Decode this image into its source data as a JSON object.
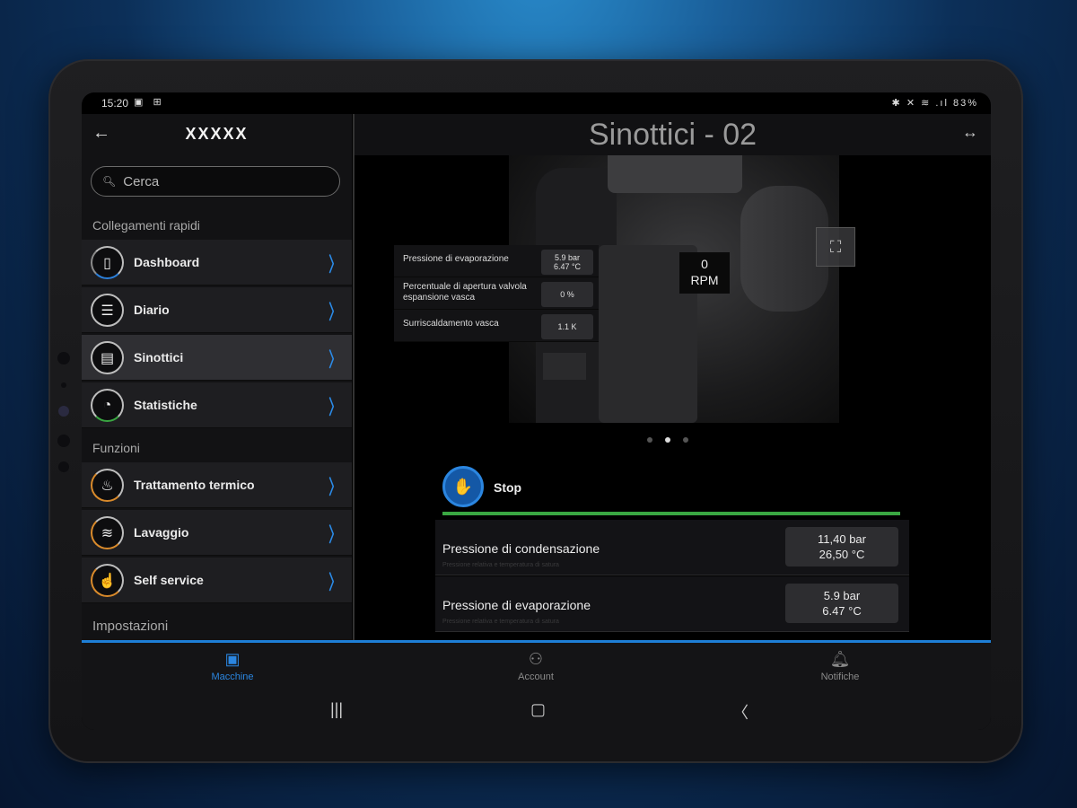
{
  "statusbar": {
    "time": "15:20",
    "left_icons": "▣ ⊞",
    "right": "✱ ✕ ≋ .ıl 83%"
  },
  "left": {
    "title": "XXXXX",
    "search_placeholder": "Cerca",
    "section_quick": "Collegamenti rapidi",
    "quick_items": [
      {
        "label": "Dashboard",
        "icon": "dashboard-icon"
      },
      {
        "label": "Diario",
        "icon": "journal-icon"
      },
      {
        "label": "Sinottici",
        "icon": "synoptic-icon"
      },
      {
        "label": "Statistiche",
        "icon": "statistics-icon"
      }
    ],
    "section_functions": "Funzioni",
    "function_items": [
      {
        "label": "Trattamento termico",
        "icon": "heat-treatment-icon"
      },
      {
        "label": "Lavaggio",
        "icon": "wash-icon"
      },
      {
        "label": "Self service",
        "icon": "self-service-icon"
      }
    ],
    "section_settings": "Impostazioni"
  },
  "right": {
    "title": "Sinottici - 02",
    "rpm_value": "0",
    "rpm_unit": "RPM",
    "params": [
      {
        "label": "Pressione di evaporazione",
        "value1": "5.9 bar",
        "value2": "6.47 °C"
      },
      {
        "label": "Percentuale di apertura valvola espansione vasca",
        "value1": "0 %",
        "value2": ""
      },
      {
        "label": "Surriscaldamento vasca",
        "value1": "1.1 K",
        "value2": ""
      }
    ],
    "pagination": {
      "total": 3,
      "active": 2
    },
    "status_label": "Stop",
    "status_icon_text": "STOP",
    "measures": [
      {
        "label": "Pressione di condensazione",
        "value1": "11,40 bar",
        "value2": "26,50 °C",
        "sub": "Pressione relativa e temperatura di satura"
      },
      {
        "label": "Pressione di evaporazione",
        "value1": "5.9 bar",
        "value2": "6.47 °C",
        "sub": "Pressione relativa e temperatura di satura"
      }
    ]
  },
  "bottom_nav": [
    {
      "label": "Macchine",
      "active": true
    },
    {
      "label": "Account",
      "active": false
    },
    {
      "label": "Notifiche",
      "active": false
    }
  ],
  "colors": {
    "accent_blue": "#2b86e0",
    "status_green": "#3aa742",
    "background": "#000000"
  }
}
